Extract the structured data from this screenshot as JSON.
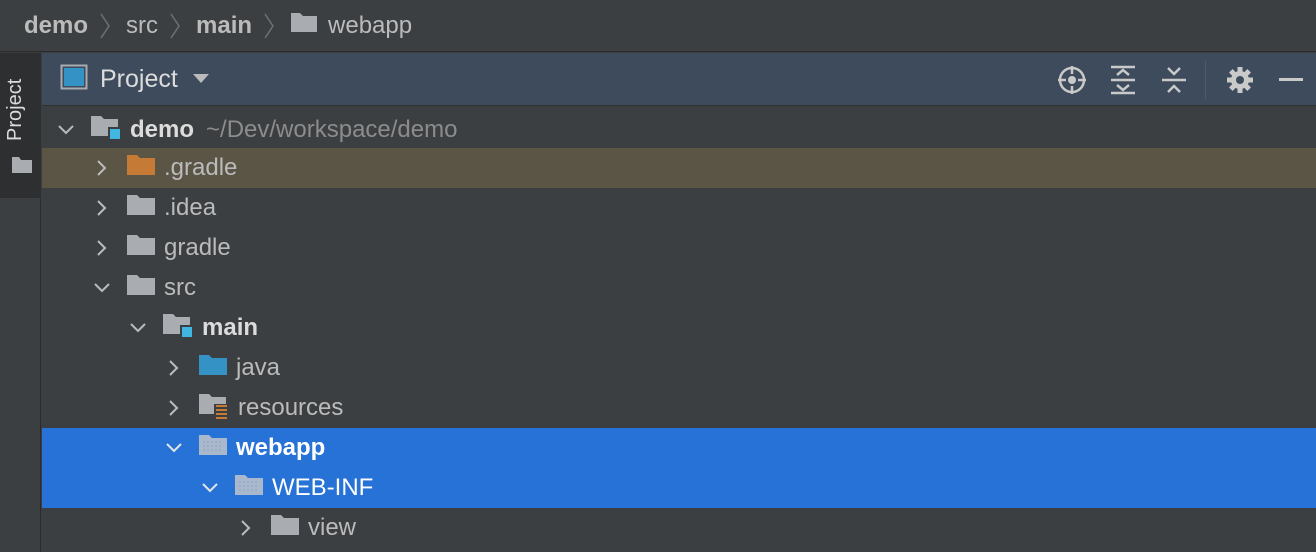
{
  "breadcrumb": {
    "items": [
      {
        "label": "demo",
        "bold": true
      },
      {
        "label": "src",
        "bold": false
      },
      {
        "label": "main",
        "bold": true
      },
      {
        "label": "webapp",
        "bold": false
      }
    ]
  },
  "tool_strip": {
    "tab_label": "Project"
  },
  "panel": {
    "title": "Project",
    "actions": [
      "locate-icon",
      "expand-all-icon",
      "collapse-all-icon",
      "gear-icon",
      "minimize-icon"
    ]
  },
  "tree": {
    "rows": [
      {
        "label": "demo",
        "path": "~/Dev/workspace/demo"
      },
      {
        "label": ".gradle"
      },
      {
        "label": ".idea"
      },
      {
        "label": "gradle"
      },
      {
        "label": "src"
      },
      {
        "label": "main"
      },
      {
        "label": "java"
      },
      {
        "label": "resources"
      },
      {
        "label": "webapp"
      },
      {
        "label": "WEB-INF"
      },
      {
        "label": "view"
      }
    ]
  },
  "colors": {
    "background": "#3c3f41",
    "panel_header": "#3d4b5c",
    "selection": "#2672d6",
    "excluded_highlight": "#5b5546",
    "folder_gray": "#a9adb1",
    "folder_orange": "#c57a36",
    "folder_blue": "#3592c4",
    "module_badge": "#40b6e0"
  }
}
